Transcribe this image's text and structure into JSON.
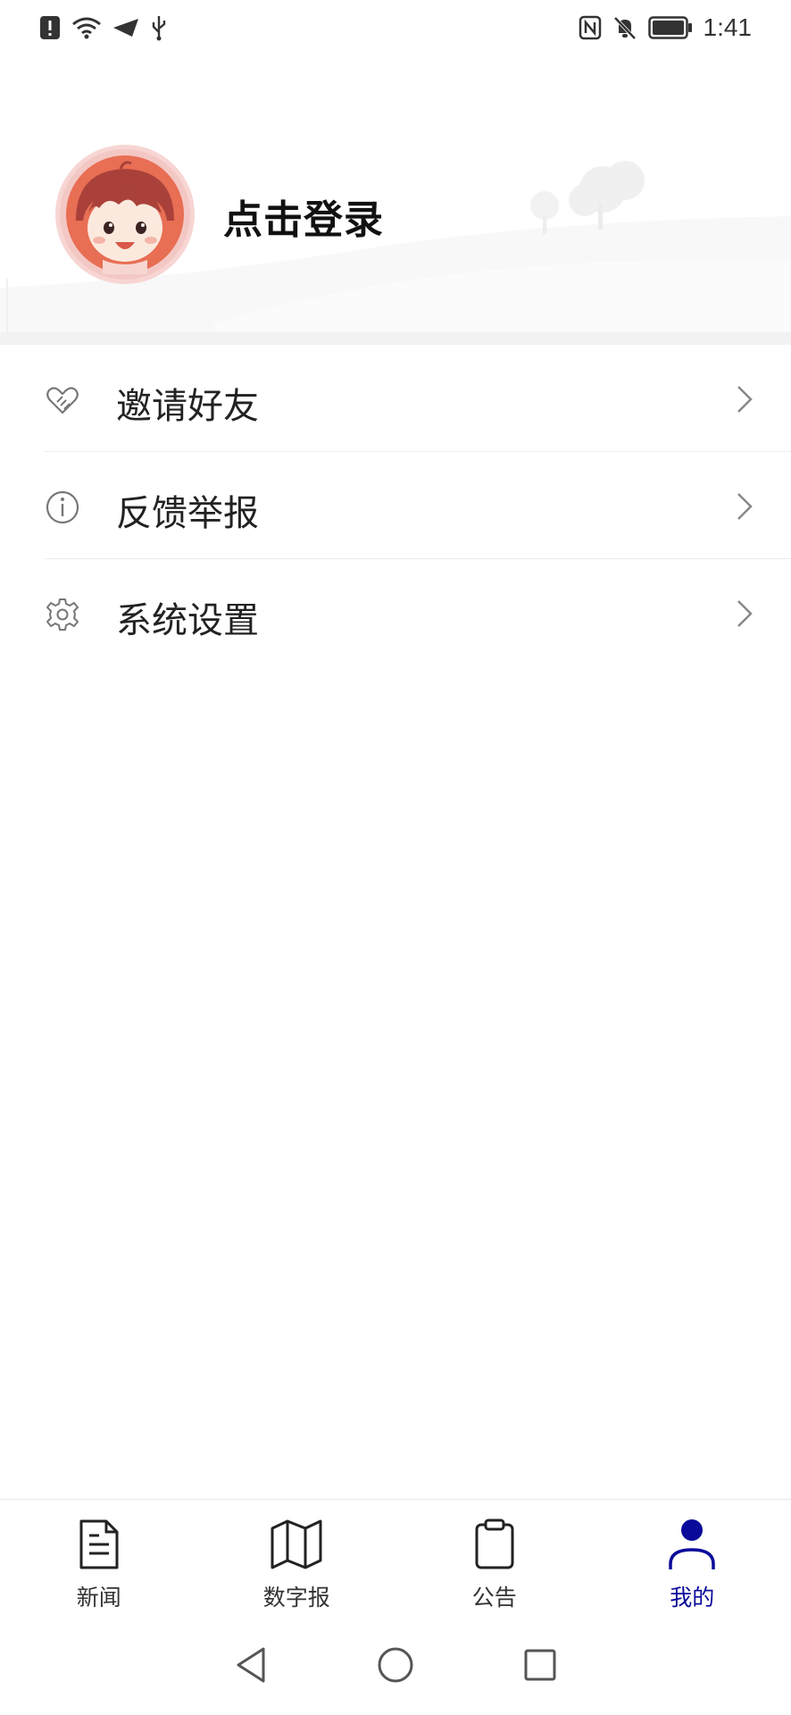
{
  "status_bar": {
    "time": "1:41",
    "left_icons": [
      "alert-icon",
      "wifi-icon",
      "send-icon",
      "usb-icon"
    ],
    "right_icons": [
      "nfc-icon",
      "mute-bell-icon",
      "battery-icon"
    ]
  },
  "profile": {
    "login_label": "点击登录",
    "avatar_icon": "avatar-girl"
  },
  "menu": {
    "items": [
      {
        "label": "邀请好友",
        "icon": "heart-hand-icon"
      },
      {
        "label": "反馈举报",
        "icon": "info-icon"
      },
      {
        "label": "系统设置",
        "icon": "gear-icon"
      }
    ]
  },
  "bottom_nav": {
    "items": [
      {
        "label": "新闻",
        "icon": "document-icon"
      },
      {
        "label": "数字报",
        "icon": "map-icon"
      },
      {
        "label": "公告",
        "icon": "clipboard-icon"
      },
      {
        "label": "我的",
        "icon": "person-icon"
      }
    ],
    "active_index": 3,
    "active_color": "#0a0a9a"
  },
  "system_nav": [
    "back-icon",
    "home-icon",
    "recents-icon"
  ]
}
